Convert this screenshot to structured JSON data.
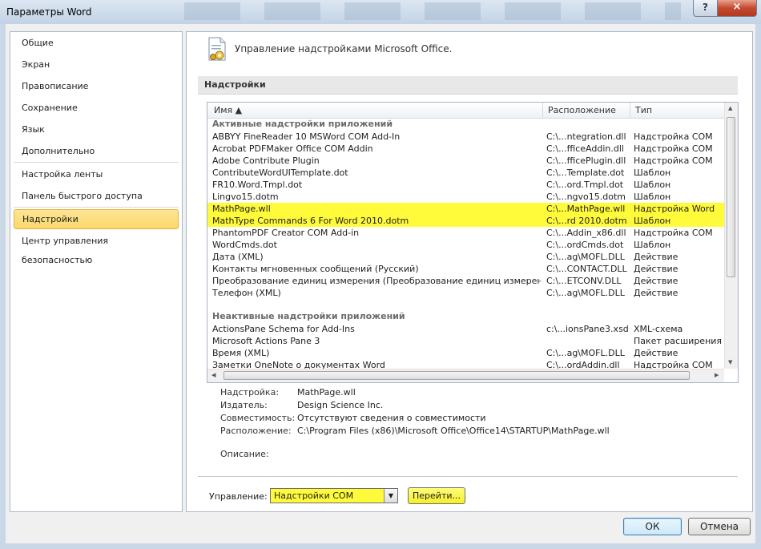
{
  "window": {
    "title": "Параметры Word",
    "help": "?",
    "close": "×"
  },
  "nav": {
    "items": [
      {
        "label": "Общие"
      },
      {
        "label": "Экран"
      },
      {
        "label": "Правописание"
      },
      {
        "label": "Сохранение"
      },
      {
        "label": "Язык"
      },
      {
        "label": "Дополнительно"
      },
      {
        "label": "Настройка ленты"
      },
      {
        "label": "Панель быстрого доступа"
      },
      {
        "label": "Надстройки"
      },
      {
        "label": "Центр управления безопасностью"
      }
    ],
    "active": "Надстройки"
  },
  "header": {
    "title": "Управление надстройками Microsoft Office."
  },
  "section": {
    "title": "Надстройки"
  },
  "list": {
    "columns": {
      "name": "Имя ▲",
      "location": "Расположение",
      "type": "Тип"
    },
    "active_group": "Активные надстройки приложений",
    "active_rows": [
      {
        "name": "ABBYY FineReader 10 MSWord COM Add-In",
        "location": "C:\\...ntegration.dll",
        "type": "Надстройка COM"
      },
      {
        "name": "Acrobat PDFMaker Office COM Addin",
        "location": "C:\\...fficeAddin.dll",
        "type": "Надстройка COM"
      },
      {
        "name": "Adobe Contribute Plugin",
        "location": "C:\\...fficePlugin.dll",
        "type": "Надстройка COM"
      },
      {
        "name": "ContributeWordUITemplate.dot",
        "location": "C:\\...Template.dot",
        "type": "Шаблон"
      },
      {
        "name": "FR10.Word.Tmpl.dot",
        "location": "C:\\...ord.Tmpl.dot",
        "type": "Шаблон"
      },
      {
        "name": "Lingvo15.dotm",
        "location": "C:\\...ngvo15.dotm",
        "type": "Шаблон"
      },
      {
        "name": "MathPage.wll",
        "location": "C:\\...MathPage.wll",
        "type": "Надстройка Word",
        "highlight": true
      },
      {
        "name": "MathType Commands 6 For Word 2010.dotm",
        "location": "C:\\...rd 2010.dotm",
        "type": "Шаблон",
        "highlight": true
      },
      {
        "name": "PhantomPDF Creator COM Add-in",
        "location": "C:\\...Addin_x86.dll",
        "type": "Надстройка COM"
      },
      {
        "name": "WordCmds.dot",
        "location": "C:\\...ordCmds.dot",
        "type": "Шаблон"
      },
      {
        "name": "Дата (XML)",
        "location": "C:\\...ag\\MOFL.DLL",
        "type": "Действие"
      },
      {
        "name": "Контакты мгновенных сообщений (Русский)",
        "location": "C:\\...CONTACT.DLL",
        "type": "Действие"
      },
      {
        "name": "Преобразование единиц измерения (Преобразование единиц измерения)",
        "location": "C:\\...ETCONV.DLL",
        "type": "Действие"
      },
      {
        "name": "Телефон (XML)",
        "location": "C:\\...ag\\MOFL.DLL",
        "type": "Действие"
      }
    ],
    "inactive_group": "Неактивные надстройки приложений",
    "inactive_rows": [
      {
        "name": "ActionsPane Schema for Add-Ins",
        "location": "c:\\...ionsPane3.xsd",
        "type": "XML-схема"
      },
      {
        "name": "Microsoft Actions Pane 3",
        "location": "",
        "type": "Пакет расширения XML"
      },
      {
        "name": "Время (XML)",
        "location": "C:\\...ag\\MOFL.DLL",
        "type": "Действие"
      },
      {
        "name": "Заметки OneNote о документах Word",
        "location": "C:\\...ordAddin.dll",
        "type": "Надстройка COM"
      }
    ]
  },
  "details": {
    "addin_label": "Надстройка:",
    "addin": "MathPage.wll",
    "publisher_label": "Издатель:",
    "publisher": "Design Science Inc.",
    "compat_label": "Совместимость:",
    "compat": "Отсутствуют сведения о совместимости",
    "location_label": "Расположение:",
    "location": "C:\\Program Files (x86)\\Microsoft Office\\Office14\\STARTUP\\MathPage.wll",
    "description_label": "Описание:"
  },
  "manage": {
    "label": "Управление:",
    "value": "Надстройки COM",
    "go_label": "Перейти..."
  },
  "buttons": {
    "ok": "ОК",
    "cancel": "Отмена"
  },
  "colors": {
    "highlight": "#fffb3a",
    "nav_active": "#fbd869"
  }
}
